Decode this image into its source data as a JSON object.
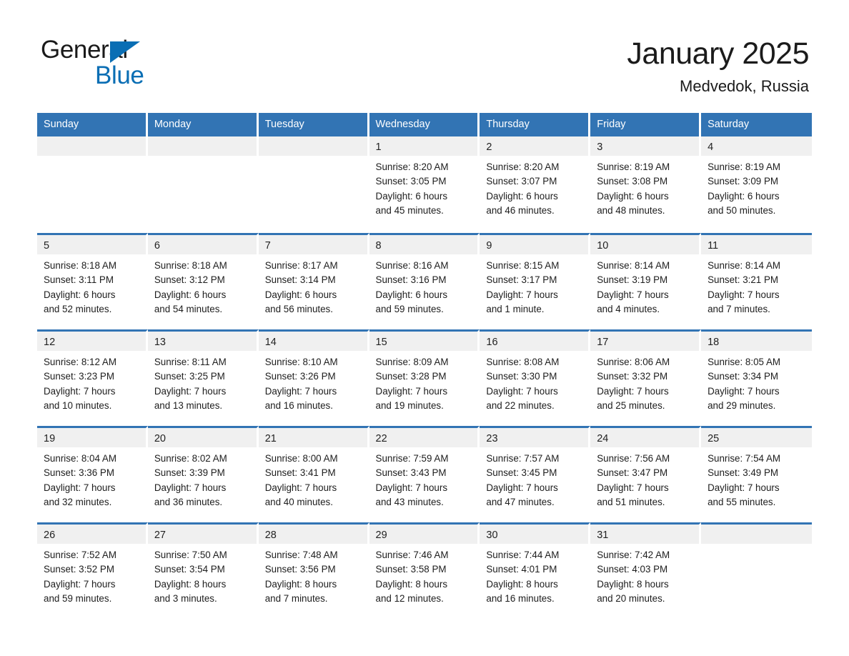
{
  "brand": {
    "logo_general": "General",
    "logo_blue": "Blue",
    "logo_icon": "triangle-logo-icon",
    "accent_color": "#0a6eb4"
  },
  "header": {
    "title": "January 2025",
    "location": "Medvedok, Russia"
  },
  "theme": {
    "header_row_bg": "#3274b4",
    "daynum_bg": "#f0f0f0",
    "text_color": "#1d1d1d"
  },
  "weekday_headers": [
    "Sunday",
    "Monday",
    "Tuesday",
    "Wednesday",
    "Thursday",
    "Friday",
    "Saturday"
  ],
  "weeks": [
    [
      {
        "day": "",
        "blank": true,
        "sunrise": "",
        "sunset": "",
        "daylight1": "",
        "daylight2": ""
      },
      {
        "day": "",
        "blank": true,
        "sunrise": "",
        "sunset": "",
        "daylight1": "",
        "daylight2": ""
      },
      {
        "day": "",
        "blank": true,
        "sunrise": "",
        "sunset": "",
        "daylight1": "",
        "daylight2": ""
      },
      {
        "day": "1",
        "sunrise": "Sunrise: 8:20 AM",
        "sunset": "Sunset: 3:05 PM",
        "daylight1": "Daylight: 6 hours",
        "daylight2": "and 45 minutes."
      },
      {
        "day": "2",
        "sunrise": "Sunrise: 8:20 AM",
        "sunset": "Sunset: 3:07 PM",
        "daylight1": "Daylight: 6 hours",
        "daylight2": "and 46 minutes."
      },
      {
        "day": "3",
        "sunrise": "Sunrise: 8:19 AM",
        "sunset": "Sunset: 3:08 PM",
        "daylight1": "Daylight: 6 hours",
        "daylight2": "and 48 minutes."
      },
      {
        "day": "4",
        "sunrise": "Sunrise: 8:19 AM",
        "sunset": "Sunset: 3:09 PM",
        "daylight1": "Daylight: 6 hours",
        "daylight2": "and 50 minutes."
      }
    ],
    [
      {
        "day": "5",
        "sunrise": "Sunrise: 8:18 AM",
        "sunset": "Sunset: 3:11 PM",
        "daylight1": "Daylight: 6 hours",
        "daylight2": "and 52 minutes."
      },
      {
        "day": "6",
        "sunrise": "Sunrise: 8:18 AM",
        "sunset": "Sunset: 3:12 PM",
        "daylight1": "Daylight: 6 hours",
        "daylight2": "and 54 minutes."
      },
      {
        "day": "7",
        "sunrise": "Sunrise: 8:17 AM",
        "sunset": "Sunset: 3:14 PM",
        "daylight1": "Daylight: 6 hours",
        "daylight2": "and 56 minutes."
      },
      {
        "day": "8",
        "sunrise": "Sunrise: 8:16 AM",
        "sunset": "Sunset: 3:16 PM",
        "daylight1": "Daylight: 6 hours",
        "daylight2": "and 59 minutes."
      },
      {
        "day": "9",
        "sunrise": "Sunrise: 8:15 AM",
        "sunset": "Sunset: 3:17 PM",
        "daylight1": "Daylight: 7 hours",
        "daylight2": "and 1 minute."
      },
      {
        "day": "10",
        "sunrise": "Sunrise: 8:14 AM",
        "sunset": "Sunset: 3:19 PM",
        "daylight1": "Daylight: 7 hours",
        "daylight2": "and 4 minutes."
      },
      {
        "day": "11",
        "sunrise": "Sunrise: 8:14 AM",
        "sunset": "Sunset: 3:21 PM",
        "daylight1": "Daylight: 7 hours",
        "daylight2": "and 7 minutes."
      }
    ],
    [
      {
        "day": "12",
        "sunrise": "Sunrise: 8:12 AM",
        "sunset": "Sunset: 3:23 PM",
        "daylight1": "Daylight: 7 hours",
        "daylight2": "and 10 minutes."
      },
      {
        "day": "13",
        "sunrise": "Sunrise: 8:11 AM",
        "sunset": "Sunset: 3:25 PM",
        "daylight1": "Daylight: 7 hours",
        "daylight2": "and 13 minutes."
      },
      {
        "day": "14",
        "sunrise": "Sunrise: 8:10 AM",
        "sunset": "Sunset: 3:26 PM",
        "daylight1": "Daylight: 7 hours",
        "daylight2": "and 16 minutes."
      },
      {
        "day": "15",
        "sunrise": "Sunrise: 8:09 AM",
        "sunset": "Sunset: 3:28 PM",
        "daylight1": "Daylight: 7 hours",
        "daylight2": "and 19 minutes."
      },
      {
        "day": "16",
        "sunrise": "Sunrise: 8:08 AM",
        "sunset": "Sunset: 3:30 PM",
        "daylight1": "Daylight: 7 hours",
        "daylight2": "and 22 minutes."
      },
      {
        "day": "17",
        "sunrise": "Sunrise: 8:06 AM",
        "sunset": "Sunset: 3:32 PM",
        "daylight1": "Daylight: 7 hours",
        "daylight2": "and 25 minutes."
      },
      {
        "day": "18",
        "sunrise": "Sunrise: 8:05 AM",
        "sunset": "Sunset: 3:34 PM",
        "daylight1": "Daylight: 7 hours",
        "daylight2": "and 29 minutes."
      }
    ],
    [
      {
        "day": "19",
        "sunrise": "Sunrise: 8:04 AM",
        "sunset": "Sunset: 3:36 PM",
        "daylight1": "Daylight: 7 hours",
        "daylight2": "and 32 minutes."
      },
      {
        "day": "20",
        "sunrise": "Sunrise: 8:02 AM",
        "sunset": "Sunset: 3:39 PM",
        "daylight1": "Daylight: 7 hours",
        "daylight2": "and 36 minutes."
      },
      {
        "day": "21",
        "sunrise": "Sunrise: 8:00 AM",
        "sunset": "Sunset: 3:41 PM",
        "daylight1": "Daylight: 7 hours",
        "daylight2": "and 40 minutes."
      },
      {
        "day": "22",
        "sunrise": "Sunrise: 7:59 AM",
        "sunset": "Sunset: 3:43 PM",
        "daylight1": "Daylight: 7 hours",
        "daylight2": "and 43 minutes."
      },
      {
        "day": "23",
        "sunrise": "Sunrise: 7:57 AM",
        "sunset": "Sunset: 3:45 PM",
        "daylight1": "Daylight: 7 hours",
        "daylight2": "and 47 minutes."
      },
      {
        "day": "24",
        "sunrise": "Sunrise: 7:56 AM",
        "sunset": "Sunset: 3:47 PM",
        "daylight1": "Daylight: 7 hours",
        "daylight2": "and 51 minutes."
      },
      {
        "day": "25",
        "sunrise": "Sunrise: 7:54 AM",
        "sunset": "Sunset: 3:49 PM",
        "daylight1": "Daylight: 7 hours",
        "daylight2": "and 55 minutes."
      }
    ],
    [
      {
        "day": "26",
        "sunrise": "Sunrise: 7:52 AM",
        "sunset": "Sunset: 3:52 PM",
        "daylight1": "Daylight: 7 hours",
        "daylight2": "and 59 minutes."
      },
      {
        "day": "27",
        "sunrise": "Sunrise: 7:50 AM",
        "sunset": "Sunset: 3:54 PM",
        "daylight1": "Daylight: 8 hours",
        "daylight2": "and 3 minutes."
      },
      {
        "day": "28",
        "sunrise": "Sunrise: 7:48 AM",
        "sunset": "Sunset: 3:56 PM",
        "daylight1": "Daylight: 8 hours",
        "daylight2": "and 7 minutes."
      },
      {
        "day": "29",
        "sunrise": "Sunrise: 7:46 AM",
        "sunset": "Sunset: 3:58 PM",
        "daylight1": "Daylight: 8 hours",
        "daylight2": "and 12 minutes."
      },
      {
        "day": "30",
        "sunrise": "Sunrise: 7:44 AM",
        "sunset": "Sunset: 4:01 PM",
        "daylight1": "Daylight: 8 hours",
        "daylight2": "and 16 minutes."
      },
      {
        "day": "31",
        "sunrise": "Sunrise: 7:42 AM",
        "sunset": "Sunset: 4:03 PM",
        "daylight1": "Daylight: 8 hours",
        "daylight2": "and 20 minutes."
      },
      {
        "day": "",
        "blank": true,
        "sunrise": "",
        "sunset": "",
        "daylight1": "",
        "daylight2": ""
      }
    ]
  ]
}
